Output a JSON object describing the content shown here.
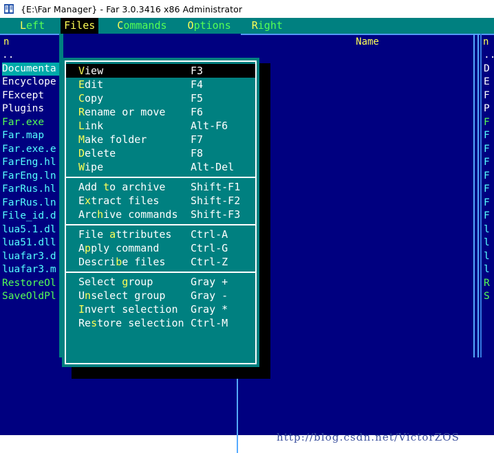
{
  "window": {
    "title": "{E:\\Far Manager} - Far 3.0.3416 x86 Administrator",
    "icon": "far-manager-book-icon"
  },
  "menubar": {
    "items": [
      {
        "label": "Left",
        "hotkey_index": 0,
        "active": false
      },
      {
        "label": "Files",
        "hotkey_index": 0,
        "active": true
      },
      {
        "label": "Commands",
        "hotkey_index": 0,
        "active": false
      },
      {
        "label": "Options",
        "hotkey_index": 0,
        "active": false
      },
      {
        "label": "Right",
        "hotkey_index": 0,
        "active": false
      }
    ]
  },
  "dropdown": {
    "owner": "Files",
    "groups": [
      {
        "items": [
          {
            "label": "View",
            "hotkey_index": 0,
            "key": "F3",
            "selected": true
          },
          {
            "label": "Edit",
            "hotkey_index": 0,
            "key": "F4",
            "selected": false
          },
          {
            "label": "Copy",
            "hotkey_index": 0,
            "key": "F5",
            "selected": false
          },
          {
            "label": "Rename or move",
            "hotkey_index": 0,
            "key": "F6",
            "selected": false
          },
          {
            "label": "Link",
            "hotkey_index": 0,
            "key": "Alt-F6",
            "selected": false
          },
          {
            "label": "Make folder",
            "hotkey_index": 0,
            "key": "F7",
            "selected": false
          },
          {
            "label": "Delete",
            "hotkey_index": 0,
            "key": "F8",
            "selected": false
          },
          {
            "label": "Wipe",
            "hotkey_index": 0,
            "key": "Alt-Del",
            "selected": false
          }
        ]
      },
      {
        "items": [
          {
            "label": "Add to archive",
            "hotkey_index": 4,
            "key": "Shift-F1",
            "selected": false
          },
          {
            "label": "Extract files",
            "hotkey_index": 1,
            "key": "Shift-F2",
            "selected": false
          },
          {
            "label": "Archive commands",
            "hotkey_index": 3,
            "key": "Shift-F3",
            "selected": false
          }
        ]
      },
      {
        "items": [
          {
            "label": "File attributes",
            "hotkey_index": 5,
            "key": "Ctrl-A",
            "selected": false
          },
          {
            "label": "Apply command",
            "hotkey_index": 1,
            "key": "Ctrl-G",
            "selected": false
          },
          {
            "label": "Describe files",
            "hotkey_index": 6,
            "key": "Ctrl-Z",
            "selected": false
          }
        ]
      },
      {
        "items": [
          {
            "label": "Select group",
            "hotkey_index": 7,
            "key": "Gray +",
            "selected": false
          },
          {
            "label": "Unselect group",
            "hotkey_index": 1,
            "key": "Gray -",
            "selected": false
          },
          {
            "label": "Invert selection",
            "hotkey_index": 0,
            "key": "Gray *",
            "selected": false
          },
          {
            "label": "Restore selection",
            "hotkey_index": 2,
            "key": "Ctrl-M",
            "selected": false
          }
        ]
      }
    ]
  },
  "left_panel": {
    "header": "n",
    "rows": [
      {
        "name": "..",
        "kind": "up",
        "selected": false
      },
      {
        "name": "Documenta",
        "kind": "dir",
        "selected": true
      },
      {
        "name": "Encyclope",
        "kind": "dir",
        "selected": false
      },
      {
        "name": "FExcept",
        "kind": "dir",
        "selected": false
      },
      {
        "name": "Plugins",
        "kind": "dir",
        "selected": false
      },
      {
        "name": "Far.exe",
        "kind": "exe",
        "selected": false
      },
      {
        "name": "Far.map",
        "kind": "file",
        "selected": false
      },
      {
        "name": "Far.exe.e",
        "kind": "file",
        "selected": false
      },
      {
        "name": "FarEng.hl",
        "kind": "file",
        "selected": false
      },
      {
        "name": "FarEng.ln",
        "kind": "file",
        "selected": false
      },
      {
        "name": "FarRus.hl",
        "kind": "file",
        "selected": false
      },
      {
        "name": "FarRus.ln",
        "kind": "file",
        "selected": false
      },
      {
        "name": "File_id.d",
        "kind": "file",
        "selected": false
      },
      {
        "name": "lua5.1.dl",
        "kind": "file",
        "selected": false
      },
      {
        "name": "lua51.dll",
        "kind": "file",
        "selected": false
      },
      {
        "name": "luafar3.d",
        "kind": "file",
        "selected": false
      },
      {
        "name": "luafar3.m",
        "kind": "file",
        "selected": false
      },
      {
        "name": "RestoreOl",
        "kind": "exe",
        "selected": false
      },
      {
        "name": "SaveOldPl",
        "kind": "exe",
        "selected": false
      }
    ]
  },
  "right_panel": {
    "column_header": "Name",
    "header": "n",
    "rows": [
      {
        "name": "..",
        "kind": "up",
        "selected": false
      },
      {
        "name": "D",
        "kind": "dir",
        "selected": false
      },
      {
        "name": "E",
        "kind": "dir",
        "selected": false
      },
      {
        "name": "F",
        "kind": "dir",
        "selected": false
      },
      {
        "name": "P",
        "kind": "dir",
        "selected": false
      },
      {
        "name": "F",
        "kind": "exe",
        "selected": false
      },
      {
        "name": "F",
        "kind": "file",
        "selected": false
      },
      {
        "name": "F",
        "kind": "file",
        "selected": false
      },
      {
        "name": "F",
        "kind": "file",
        "selected": false
      },
      {
        "name": "F",
        "kind": "file",
        "selected": false
      },
      {
        "name": "F",
        "kind": "file",
        "selected": false
      },
      {
        "name": "F",
        "kind": "file",
        "selected": false
      },
      {
        "name": "F",
        "kind": "file",
        "selected": false
      },
      {
        "name": "l",
        "kind": "file",
        "selected": false
      },
      {
        "name": "l",
        "kind": "file",
        "selected": false
      },
      {
        "name": "l",
        "kind": "file",
        "selected": false
      },
      {
        "name": "l",
        "kind": "file",
        "selected": false
      },
      {
        "name": "R",
        "kind": "exe",
        "selected": false
      },
      {
        "name": "S",
        "kind": "exe",
        "selected": false
      }
    ]
  },
  "watermark": {
    "text": "http://blog.csdn.net/VictorZOS"
  },
  "colors": {
    "console_bg": "#000080",
    "menu_bg": "#008080",
    "menu_text": "#ffffff",
    "hotkey": "#ffff55",
    "menubar_text": "#55ff55",
    "selected_bg": "#000000",
    "file_exe": "#55ff55",
    "file_normal": "#55ffff",
    "file_dir": "#ffffff",
    "row_selected_bg": "#00aaaa",
    "panel_border": "#55aaff",
    "watermark": "#3a4f9e"
  }
}
